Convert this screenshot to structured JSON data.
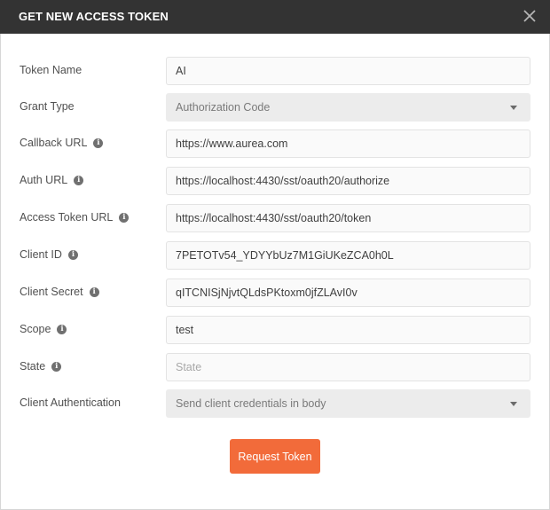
{
  "dialog": {
    "title": "GET NEW ACCESS TOKEN",
    "close_icon": "close-icon"
  },
  "form": {
    "token_name": {
      "label": "Token Name",
      "value": "AI"
    },
    "grant_type": {
      "label": "Grant Type",
      "value": "Authorization Code"
    },
    "callback_url": {
      "label": "Callback URL",
      "value": "https://www.aurea.com"
    },
    "auth_url": {
      "label": "Auth URL",
      "value": "https://localhost:4430/sst/oauth20/authorize"
    },
    "access_token_url": {
      "label": "Access Token URL",
      "value": "https://localhost:4430/sst/oauth20/token"
    },
    "client_id": {
      "label": "Client ID",
      "value": "7PETOTv54_YDYYbUz7M1GiUKeZCA0h0L"
    },
    "client_secret": {
      "label": "Client Secret",
      "value": "qITCNISjNjvtQLdsPKtoxm0jfZLAvI0v"
    },
    "scope": {
      "label": "Scope",
      "value": "test"
    },
    "state": {
      "label": "State",
      "value": "",
      "placeholder": "State"
    },
    "client_authentication": {
      "label": "Client Authentication",
      "value": "Send client credentials in body"
    }
  },
  "actions": {
    "request_token_label": "Request Token"
  },
  "colors": {
    "titlebar": "#333333",
    "primary_button": "#f26b3a"
  },
  "info_icon": "i"
}
